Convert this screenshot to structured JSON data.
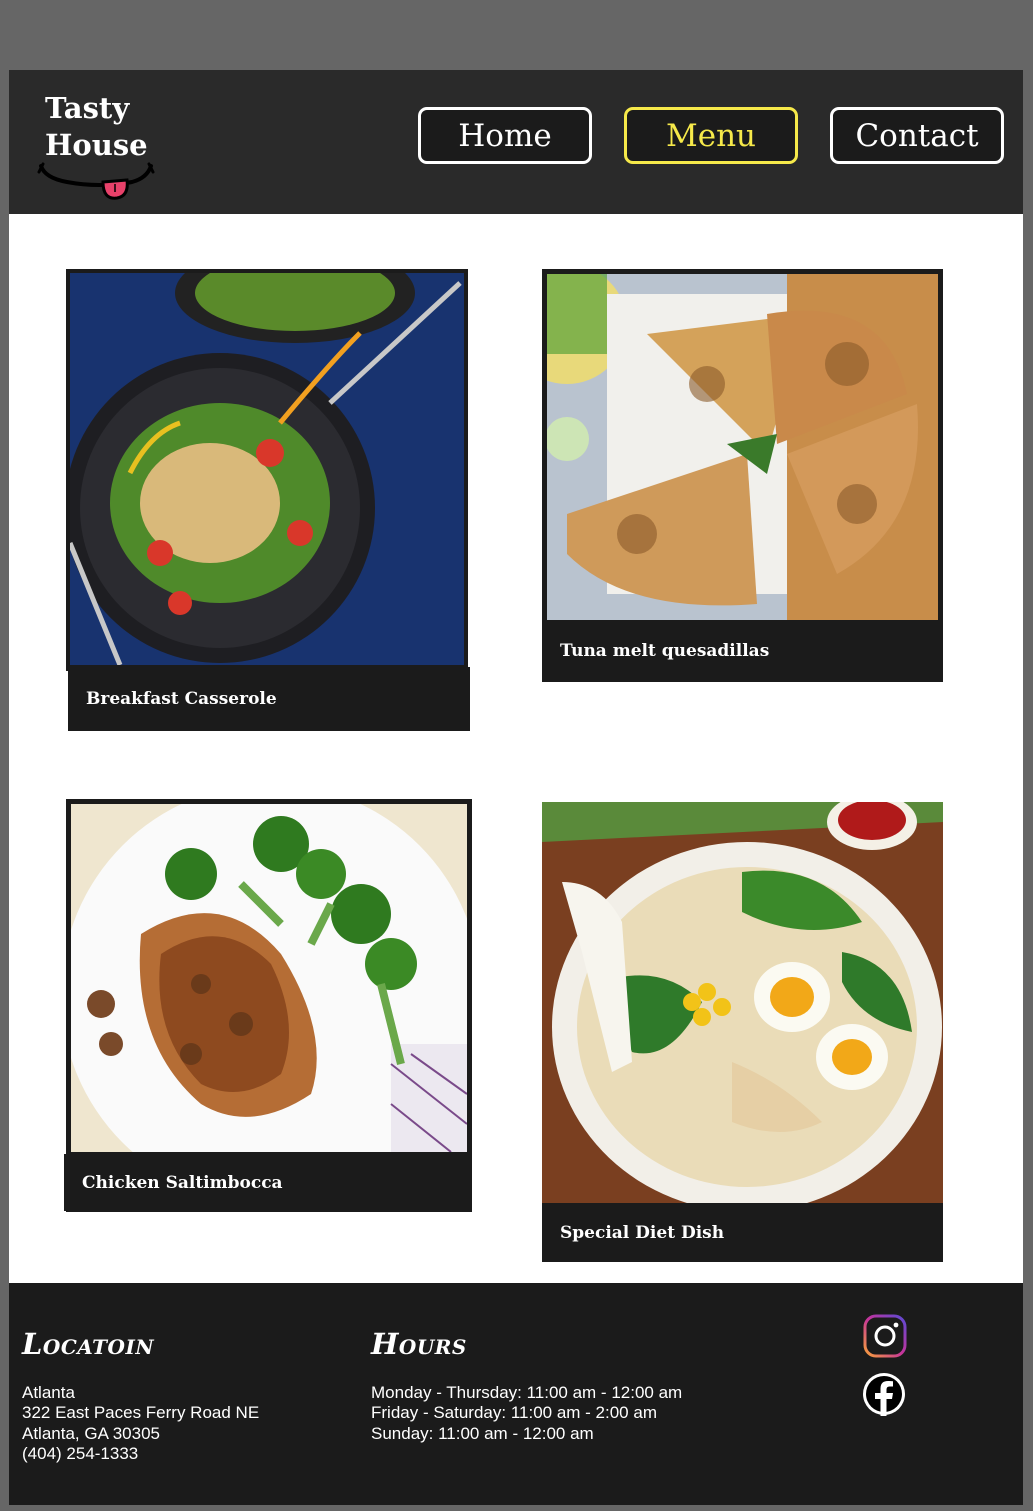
{
  "brand": {
    "line1": "Tasty",
    "line2": "House"
  },
  "nav": {
    "home": "Home",
    "menu": "Menu",
    "contact": "Contact"
  },
  "menu_items": [
    {
      "name": "Breakfast Casserole"
    },
    {
      "name": "Tuna melt quesadillas"
    },
    {
      "name": "Chicken Saltimbocca"
    },
    {
      "name": "Special Diet Dish"
    }
  ],
  "footer": {
    "location": {
      "title": "Locatoin",
      "lines": [
        "Atlanta",
        "322 East Paces Ferry Road NE",
        "Atlanta, GA 30305",
        "(404) 254-1333"
      ]
    },
    "hours": {
      "title": "Hours",
      "lines": [
        "Monday - Thursday: 11:00 am - 12:00 am",
        "Friday - Saturday: 11:00 am - 2:00 am",
        "Sunday: 11:00 am - 12:00 am"
      ]
    },
    "social": [
      "instagram-icon",
      "facebook-icon"
    ]
  },
  "colors": {
    "header_bg": "#2a2a2a",
    "active_nav": "#f6e94a",
    "footer_bg": "#1b1b1b",
    "tongue": "#e8416a"
  }
}
